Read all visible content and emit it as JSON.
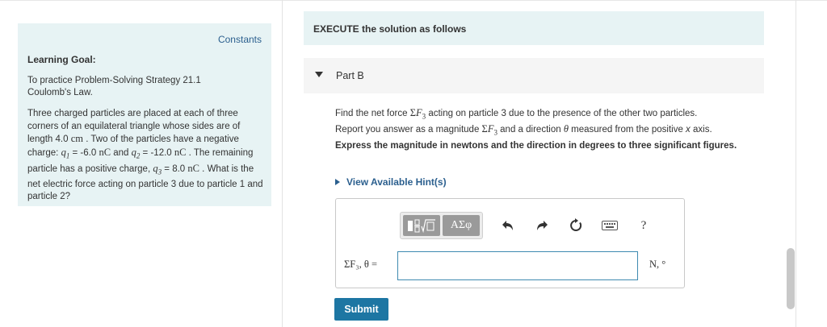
{
  "left_panel": {
    "constants_link": "Constants",
    "goal_title": "Learning Goal:",
    "goal_line1": "To practice Problem-Solving Strategy 21.1",
    "goal_line2": "Coulomb's Law.",
    "problem": {
      "t1": "Three charged particles are placed at each of three corners of an equilateral triangle whose sides are of length 4.0 ",
      "u_cm": "cm",
      "t2": " . Two of the particles have a negative charge: ",
      "q1_eq": " = -6.0 ",
      "u_nc1": "nC",
      "t3": " and ",
      "q2_eq": " = -12.0 ",
      "u_nc2": "nC",
      "t4": " . The remaining particle has a positive charge, ",
      "q3_eq": " = 8.0 ",
      "u_nc3": "nC",
      "t5": " . What is the net electric force acting on particle 3 due to particle 1 and particle 2?"
    }
  },
  "execute": {
    "banner": "EXECUTE the solution as follows"
  },
  "part": {
    "label": "Part B",
    "q_a": "Find the net force ",
    "q_b": " acting on particle 3 due to the presence of the other two particles.",
    "q_c": "Report you answer as a magnitude ",
    "q_d": " and a direction ",
    "q_e": " measured from the positive ",
    "q_f": " axis.",
    "instruction": "Express the magnitude in newtons and the direction in degrees to three significant figures.",
    "hint_link": "View Available Hint(s)"
  },
  "answer": {
    "toolbar_greek": "ΑΣφ",
    "help": "?",
    "label": "ΣF₃, θ =",
    "value": "",
    "units": "N, °",
    "submit": "Submit"
  }
}
